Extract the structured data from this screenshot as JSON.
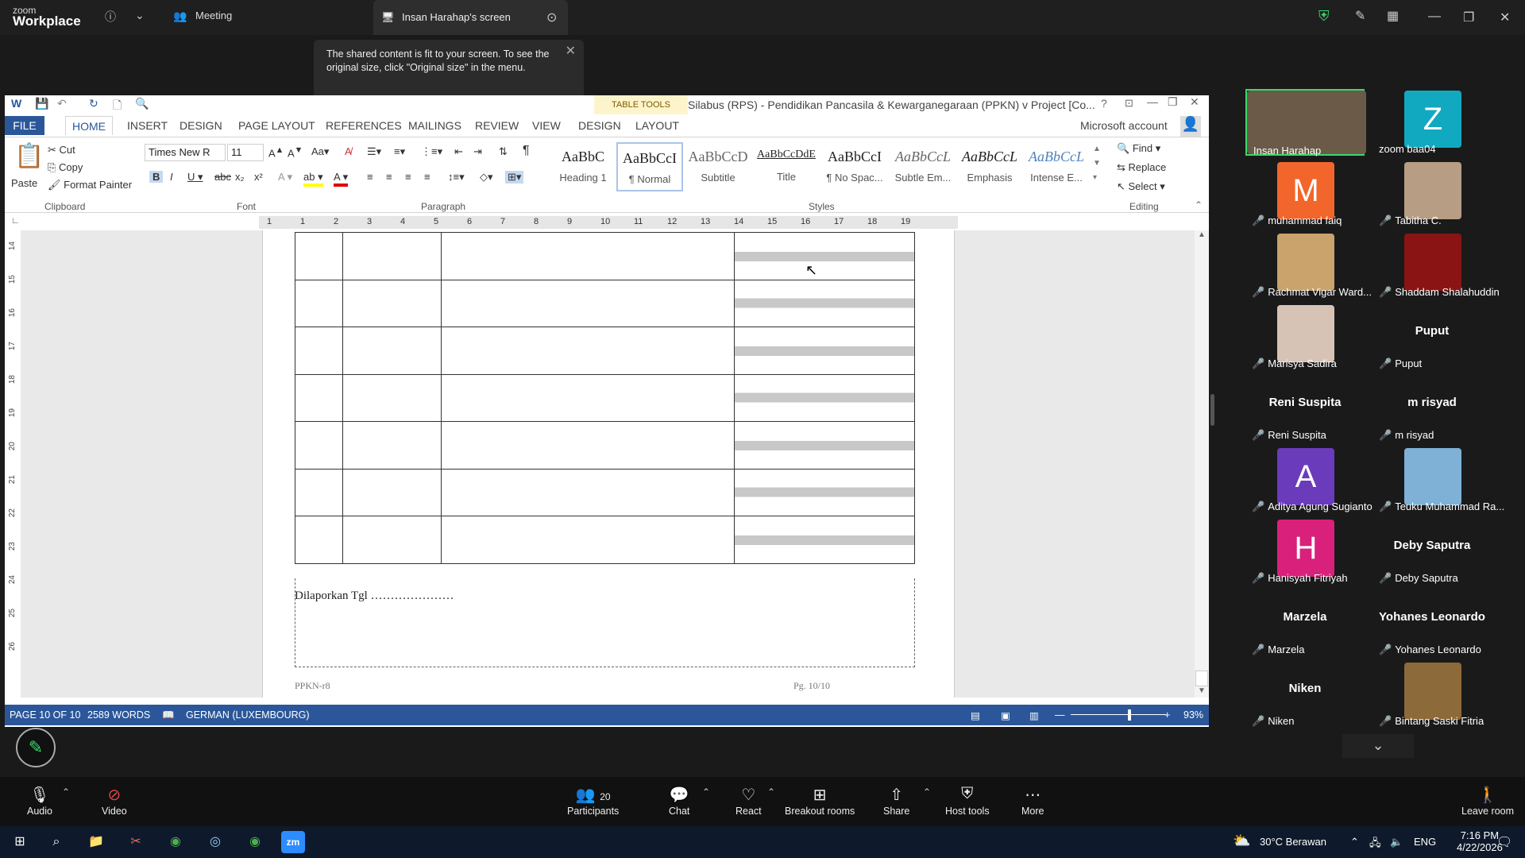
{
  "zoom": {
    "brand_small": "zoom",
    "brand_big": "Workplace",
    "meeting_label": "Meeting",
    "screen_tab_label": "Insan Harahap's screen",
    "toast_text": "The shared content is fit to your screen. To see the original size, click \"Original size\" in the menu."
  },
  "word": {
    "title": "Silabus (RPS) - Pendidikan Pancasila & Kewarganegaraan (PPKN) v Project [Co...",
    "table_tools": "TABLE TOOLS",
    "tabs": [
      "FILE",
      "HOME",
      "INSERT",
      "DESIGN",
      "PAGE LAYOUT",
      "REFERENCES",
      "MAILINGS",
      "REVIEW",
      "VIEW",
      "DESIGN",
      "LAYOUT"
    ],
    "account": "Microsoft account",
    "clipboard": {
      "paste": "Paste",
      "cut": "Cut",
      "copy": "Copy",
      "format_painter": "Format Painter",
      "label": "Clipboard"
    },
    "font": {
      "name": "Times New R",
      "size": "11",
      "label": "Font"
    },
    "paragraph_label": "Paragraph",
    "styles_label": "Styles",
    "styles": [
      {
        "sample": "AaBbC",
        "name": "Heading 1"
      },
      {
        "sample": "AaBbCcI",
        "name": "¶ Normal"
      },
      {
        "sample": "AaBbCcD",
        "name": "Subtitle"
      },
      {
        "sample": "AaBbCcDdE",
        "name": "Title"
      },
      {
        "sample": "AaBbCcI",
        "name": "¶ No Spac..."
      },
      {
        "sample": "AaBbCcL",
        "name": "Subtle Em..."
      },
      {
        "sample": "AaBbCcL",
        "name": "Emphasis"
      },
      {
        "sample": "AaBbCcL",
        "name": "Intense E..."
      }
    ],
    "editing": {
      "find": "Find",
      "replace": "Replace",
      "select": "Select",
      "label": "Editing"
    },
    "ruler_numbers": [
      "1",
      "1",
      "2",
      "3",
      "4",
      "5",
      "6",
      "7",
      "8",
      "9",
      "10",
      "11",
      "12",
      "13",
      "14",
      "15",
      "16",
      "17",
      "18",
      "19"
    ],
    "vruler_numbers": [
      "14",
      "15",
      "16",
      "17",
      "18",
      "19",
      "20",
      "21",
      "22",
      "23",
      "24",
      "25",
      "26"
    ],
    "report_line": "Dilaporkan Tgl …………………",
    "footer_left": "PPKN-r8",
    "footer_right": "Pg. 10/10",
    "status": {
      "page": "PAGE 10 OF 10",
      "words": "2589 WORDS",
      "language": "GERMAN (LUXEMBOURG)",
      "zoom": "93%"
    },
    "zoom_fraction": 0.6
  },
  "participants": [
    {
      "name": "Insan Harahap",
      "avatar": "",
      "color": "#6b5a48",
      "muted": false,
      "active": true
    },
    {
      "name": "zoom baa04",
      "avatar": "Z",
      "color": "#11a9bf",
      "muted": false
    },
    {
      "name": "muhammad faiq",
      "avatar": "M",
      "color": "#f2652b",
      "muted": true
    },
    {
      "name": "Tabitha C.",
      "avatar": "",
      "color": "#b89d85",
      "muted": true
    },
    {
      "name": "Rachmat Vigar Ward...",
      "avatar": "",
      "color": "#c9a36b",
      "muted": true
    },
    {
      "name": "Shaddam Shalahuddin",
      "avatar": "",
      "color": "#8a1414",
      "muted": true
    },
    {
      "name": "Marisya Sadira",
      "avatar": "",
      "color": "#d7c3b5",
      "muted": true
    },
    {
      "name": "Puput",
      "big": "Puput",
      "muted": true
    },
    {
      "name": "Reni Suspita",
      "big": "Reni Suspita",
      "muted": true
    },
    {
      "name": "m risyad",
      "big": "m risyad",
      "muted": true
    },
    {
      "name": "Aditya Agung Sugianto",
      "avatar": "A",
      "color": "#6a3bbb",
      "muted": true
    },
    {
      "name": "Teuku Muhammad Ra...",
      "avatar": "",
      "color": "#7fb1d6",
      "muted": true
    },
    {
      "name": "Hanisyah Fitriyah",
      "avatar": "H",
      "color": "#d9217b",
      "muted": true
    },
    {
      "name": "Deby Saputra",
      "big": "Deby Saputra",
      "muted": true
    },
    {
      "name": "Marzela",
      "big": "Marzela",
      "muted": true
    },
    {
      "name": "Yohanes Leonardo",
      "big": "Yohanes Leonardo",
      "muted": true
    },
    {
      "name": "Niken",
      "big": "Niken",
      "muted": true
    },
    {
      "name": "Bintang Saski Fitria",
      "avatar": "",
      "color": "#8d6a3a",
      "muted": true
    }
  ],
  "toolbar": {
    "audio": "Audio",
    "video": "Video",
    "participants": "Participants",
    "participant_count": "20",
    "chat": "Chat",
    "react": "React",
    "breakout": "Breakout rooms",
    "share": "Share",
    "host_tools": "Host tools",
    "more": "More",
    "leave": "Leave room"
  },
  "taskbar": {
    "weather": "30°C  Berawan",
    "lang": "ENG",
    "time": "7:16 PM",
    "date": "4/22/2026"
  }
}
